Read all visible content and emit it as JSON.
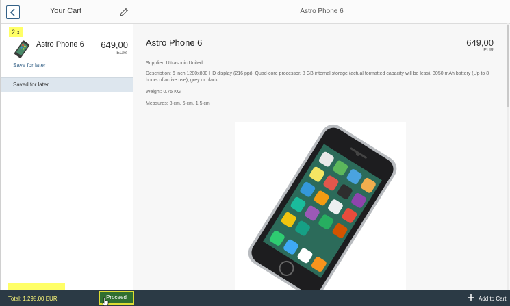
{
  "master": {
    "title": "Your Cart",
    "item": {
      "quantity": "2 x",
      "name": "Astro Phone 6",
      "price": "649,00",
      "currency": "EUR",
      "save_for_later": "Save for later"
    },
    "saved_group_label": "Saved for later"
  },
  "detail": {
    "header_title": "Astro Phone 6",
    "title": "Astro Phone 6",
    "price": "649,00",
    "currency": "EUR",
    "supplier": "Supplier: Ultrasonic United",
    "description": "Description: 6 inch 1280x800 HD display (216 ppi), Quad-core processor, 8 GB internal storage (actual formatted capacity will be less), 3050 mAh battery (Up to 8 hours of active use), grey or black",
    "weight": "Weight: 0.75 KG",
    "measures": "Measures: 8 cm, 6 cm, 1.5 cm"
  },
  "footer": {
    "total": "Total: 1.298,00 EUR",
    "proceed_label": "Proceed",
    "add_to_cart_label": "Add to Cart"
  },
  "colors": {
    "highlight": "#ffff66",
    "footer_bg": "#2b3a45",
    "link": "#346187",
    "proceed_bg": "#2f6f2f"
  },
  "icons": [
    "back-icon",
    "pencil-icon",
    "phone-thumbnail",
    "plus-icon",
    "hand-cursor-icon"
  ]
}
